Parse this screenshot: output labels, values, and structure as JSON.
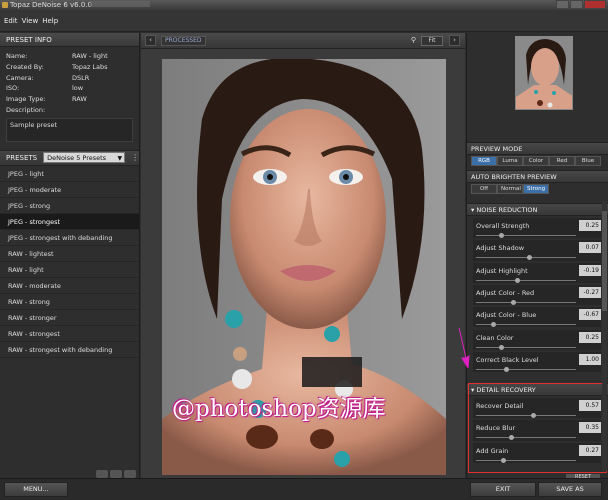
{
  "window": {
    "title": "Topaz DeNoise 6 v6.0.0"
  },
  "menu": [
    "Edit",
    "View",
    "Help"
  ],
  "preset_info": {
    "header": "PRESET INFO",
    "rows": [
      {
        "k": "Name:",
        "v": "RAW - light"
      },
      {
        "k": "Created By:",
        "v": "Topaz Labs"
      },
      {
        "k": "Camera:",
        "v": "DSLR"
      },
      {
        "k": "ISO:",
        "v": "low"
      },
      {
        "k": "Image Type:",
        "v": "RAW"
      },
      {
        "k": "Description:",
        "v": ""
      }
    ],
    "description": "Sample preset"
  },
  "presets": {
    "header": "PRESETS",
    "selected_group": "DeNoise 5 Presets",
    "items": [
      "JPEG - light",
      "JPEG - moderate",
      "JPEG - strong",
      "JPEG - strongest",
      "JPEG - strongest with debanding",
      "RAW - lightest",
      "RAW - light",
      "RAW - moderate",
      "RAW - strong",
      "RAW - stronger",
      "RAW - strongest",
      "RAW - strongest with debanding"
    ],
    "selected_index": 3
  },
  "center": {
    "view_label": "PROCESSED",
    "fit_label": "Fit",
    "watermark": "@photoshop资源库"
  },
  "preview_mode": {
    "header": "PREVIEW MODE",
    "options": [
      "RGB",
      "Luma",
      "Color",
      "Red",
      "Blue"
    ],
    "active": 0
  },
  "auto_brighten": {
    "header": "AUTO BRIGHTEN PREVIEW",
    "options": [
      "Off",
      "Normal",
      "Strong"
    ],
    "active": 2
  },
  "noise_reduction": {
    "header": "NOISE REDUCTION",
    "sliders": [
      {
        "label": "Overall Strength",
        "value": "0.25",
        "pos": 0.25
      },
      {
        "label": "Adjust Shadow",
        "value": "0.07",
        "pos": 0.53
      },
      {
        "label": "Adjust Highlight",
        "value": "-0.19",
        "pos": 0.41
      },
      {
        "label": "Adjust Color - Red",
        "value": "-0.27",
        "pos": 0.37
      },
      {
        "label": "Adjust Color - Blue",
        "value": "-0.67",
        "pos": 0.17
      },
      {
        "label": "Clean Color",
        "value": "0.25",
        "pos": 0.25
      },
      {
        "label": "Correct Black Level",
        "value": "1.00",
        "pos": 0.3
      }
    ]
  },
  "detail_recovery": {
    "header": "DETAIL RECOVERY",
    "sliders": [
      {
        "label": "Recover Detail",
        "value": "0.57",
        "pos": 0.57
      },
      {
        "label": "Reduce Blur",
        "value": "0.35",
        "pos": 0.35
      },
      {
        "label": "Add Grain",
        "value": "0.27",
        "pos": 0.27
      }
    ]
  },
  "bottom": {
    "menu_label": "MENU...",
    "exit_label": "EXIT",
    "save_label": "SAVE AS",
    "reset_label": "RESET"
  }
}
